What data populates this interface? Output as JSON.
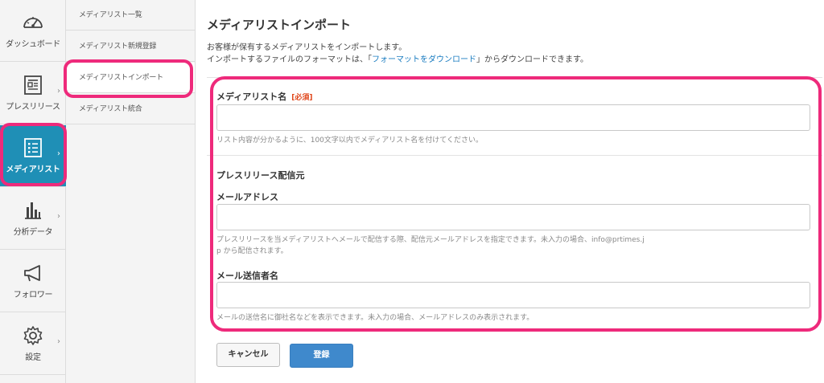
{
  "nav": {
    "items": [
      {
        "label": "ダッシュボード",
        "icon": "dashboard-icon"
      },
      {
        "label": "プレスリリース",
        "icon": "press-release-icon"
      },
      {
        "label": "メディアリスト",
        "icon": "media-list-icon"
      },
      {
        "label": "分析データ",
        "icon": "bar-chart-icon"
      },
      {
        "label": "フォロワー",
        "icon": "megaphone-icon"
      },
      {
        "label": "設定",
        "icon": "gear-icon"
      }
    ],
    "active_index": 2
  },
  "submenu": {
    "items": [
      {
        "label": "メディアリスト一覧"
      },
      {
        "label": "メディアリスト新規登録"
      },
      {
        "label": "メディアリストインポート"
      },
      {
        "label": "メディアリスト統合"
      }
    ],
    "current_index": 2
  },
  "main": {
    "title": "メディアリストインポート",
    "intro_line1": "お客様が保有するメディアリストをインポートします。",
    "intro_line2_pre": "インポートするファイルのフォーマットは、「",
    "intro_link": "フォーマットをダウンロード",
    "intro_line2_post": "」からダウンロードできます。",
    "form": {
      "list_name_label": "メディアリスト名",
      "required_badge": "[必須]",
      "list_name_value": "",
      "list_name_help": "リスト内容が分かるように、100文字以内でメディアリスト名を付けてください。",
      "sender_section_title": "プレスリリース配信元",
      "email_label": "メールアドレス",
      "email_value": "",
      "email_help_line1": "プレスリリースを当メディアリストへメールで配信する際、配信元メールアドレスを指定できます。未入力の場合、info@prtimes.j",
      "email_help_line2": "p から配信されます。",
      "sender_name_label": "メール送信者名",
      "sender_name_value": "",
      "sender_name_help": "メールの送信名に御社名などを表示できます。未入力の場合、メールアドレスのみ表示されます。"
    },
    "buttons": {
      "cancel": "キャンセル",
      "submit": "登録"
    }
  },
  "colors": {
    "accent": "#1f8fb6",
    "link": "#1a7cc0",
    "required": "#e0461a",
    "submit": "#3f89cc",
    "highlight": "#ee2a7b"
  }
}
